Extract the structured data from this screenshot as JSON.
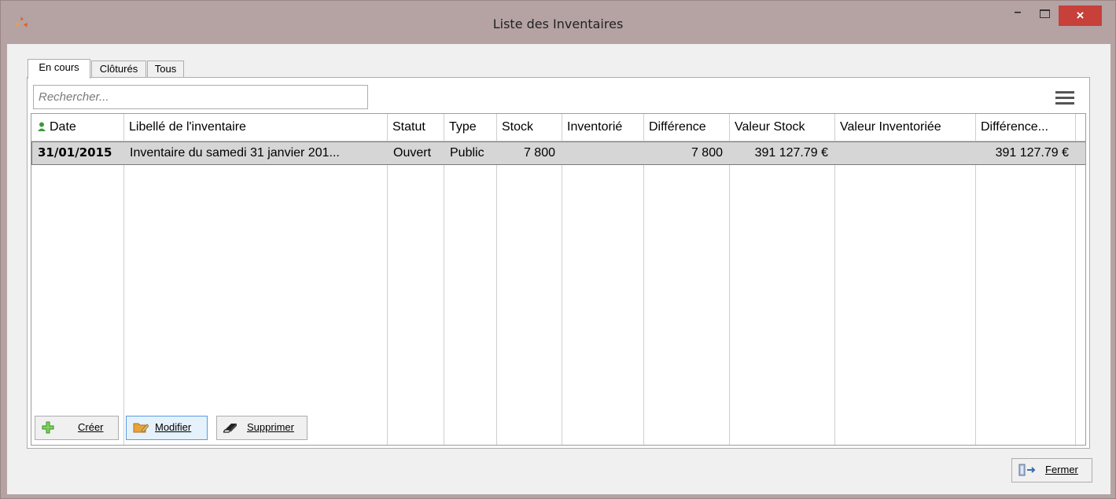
{
  "window": {
    "title": "Liste des Inventaires",
    "close_glyph": "×",
    "minimize_glyph": "–"
  },
  "tabs": [
    {
      "label": "En cours",
      "active": true
    },
    {
      "label": "Clôturés",
      "active": false
    },
    {
      "label": "Tous",
      "active": false
    }
  ],
  "search": {
    "placeholder": "Rechercher..."
  },
  "table": {
    "columns": [
      "Date",
      "Libellé de l'inventaire",
      "Statut",
      "Type",
      "Stock",
      "Inventorié",
      "Différence",
      "Valeur Stock",
      "Valeur Inventoriée",
      "Différence..."
    ],
    "rows": [
      {
        "date": "31/01/2015",
        "label": "Inventaire du samedi 31 janvier 201...",
        "status": "Ouvert",
        "type": "Public",
        "stock": "7 800",
        "inventoried": "",
        "difference": "7 800",
        "stock_value": "391 127.79 €",
        "inventoried_value": "",
        "difference_value": "391 127.79 €"
      }
    ]
  },
  "buttons": {
    "create": "Créer",
    "modify": "Modifier",
    "delete": "Supprimer",
    "close": "Fermer"
  },
  "icons": {
    "app": "app-logo-icon",
    "date_column": "green-person-icon",
    "create": "green-plus-icon",
    "modify": "folder-edit-icon",
    "delete": "eraser-icon",
    "close": "exit-door-icon",
    "menu": "hamburger-menu-icon"
  },
  "colors": {
    "titlebar": "#b5a3a3",
    "close_button": "#c7403a",
    "selected_row": "#d6d6d6",
    "modify_highlight": "#e5f1fb"
  }
}
